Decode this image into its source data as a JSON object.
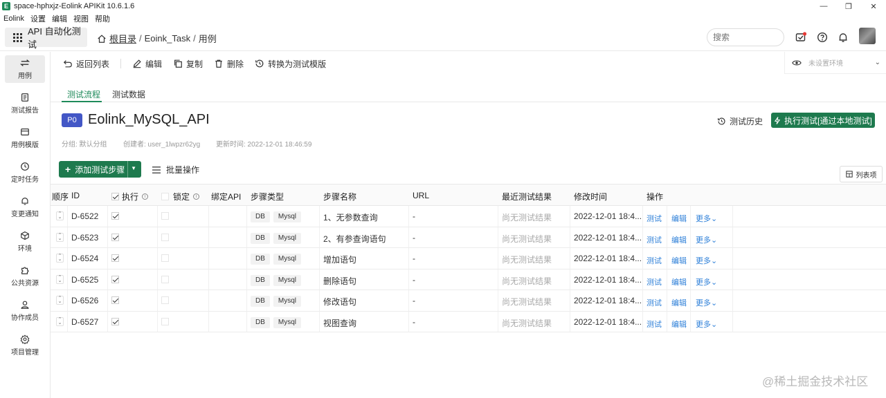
{
  "window": {
    "title": "space-hphxjz-Eolink APIKit 10.6.1.6",
    "logo_letter": "E",
    "minimize": "—",
    "maximize": "❐",
    "close": "✕"
  },
  "menu": [
    "Eolink",
    "设置",
    "编辑",
    "视图",
    "帮助"
  ],
  "header": {
    "module_label": "API 自动化测试",
    "breadcrumb": {
      "root": "根目录",
      "sep": "/",
      "project": "Eoink_Task",
      "current": "用例"
    },
    "search_placeholder": "搜索"
  },
  "sidebar": [
    {
      "label": "用例",
      "icon": "swap-icon",
      "active": true
    },
    {
      "label": "测试报告",
      "icon": "report-icon"
    },
    {
      "label": "用例模版",
      "icon": "template-icon"
    },
    {
      "label": "定时任务",
      "icon": "clock-icon"
    },
    {
      "label": "变更通知",
      "icon": "bell-icon"
    },
    {
      "label": "环境",
      "icon": "cube-icon"
    },
    {
      "label": "公共资源",
      "icon": "puzzle-icon"
    },
    {
      "label": "协作成员",
      "icon": "user-icon"
    },
    {
      "label": "项目管理",
      "icon": "gear-icon"
    }
  ],
  "toolbar": {
    "back": "返回列表",
    "edit": "编辑",
    "copy": "复制",
    "delete": "删除",
    "convert": "转换为测试模版"
  },
  "environment": {
    "label": "未设置环境"
  },
  "tabs": [
    "测试流程",
    "测试数据"
  ],
  "case": {
    "priority": "P0",
    "title": "Eolink_MySQL_API",
    "group": "分组: 默认分组",
    "creator": "创建者: user_1lwpzr62yg",
    "updated": "更新时间: 2022-12-01 18:46:59",
    "history_label": "测试历史",
    "run_label": "执行测试[通过本地测试]"
  },
  "actions": {
    "add_step": "添加测试步骤",
    "batch": "批量操作",
    "columns": "列表项"
  },
  "table": {
    "headers": {
      "order": "顺序",
      "id": "ID",
      "execute": "执行",
      "lock": "锁定",
      "bind_api": "绑定API",
      "step_type": "步骤类型",
      "step_name": "步骤名称",
      "url": "URL",
      "last_result": "最近测试结果",
      "modified": "修改时间",
      "ops": "操作"
    },
    "rows": [
      {
        "id": "D-6522",
        "type": "DB",
        "subtype": "Mysql",
        "name": "1、无参数查询",
        "url": "-",
        "result": "尚无测试结果",
        "modified": "2022-12-01 18:4...",
        "test": "测试",
        "edit": "编辑",
        "more": "更多"
      },
      {
        "id": "D-6523",
        "type": "DB",
        "subtype": "Mysql",
        "name": "2、有参查询语句",
        "url": "-",
        "result": "尚无测试结果",
        "modified": "2022-12-01 18:4...",
        "test": "测试",
        "edit": "编辑",
        "more": "更多"
      },
      {
        "id": "D-6524",
        "type": "DB",
        "subtype": "Mysql",
        "name": "增加语句",
        "url": "-",
        "result": "尚无测试结果",
        "modified": "2022-12-01 18:4...",
        "test": "测试",
        "edit": "编辑",
        "more": "更多"
      },
      {
        "id": "D-6525",
        "type": "DB",
        "subtype": "Mysql",
        "name": "删除语句",
        "url": "-",
        "result": "尚无测试结果",
        "modified": "2022-12-01 18:4...",
        "test": "测试",
        "edit": "编辑",
        "more": "更多"
      },
      {
        "id": "D-6526",
        "type": "DB",
        "subtype": "Mysql",
        "name": "修改语句",
        "url": "-",
        "result": "尚无测试结果",
        "modified": "2022-12-01 18:4...",
        "test": "测试",
        "edit": "编辑",
        "more": "更多"
      },
      {
        "id": "D-6527",
        "type": "DB",
        "subtype": "Mysql",
        "name": "视图查询",
        "url": "-",
        "result": "尚无测试结果",
        "modified": "2022-12-01 18:4...",
        "test": "测试",
        "edit": "编辑",
        "more": "更多"
      }
    ]
  },
  "watermark": "@稀土掘金技术社区",
  "colors": {
    "primary": "#1e7a4e",
    "tab_active": "#1e8a5a",
    "priority": "#4357c6",
    "link": "#2d7fd8"
  }
}
